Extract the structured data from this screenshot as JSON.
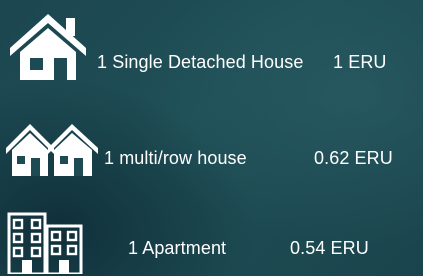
{
  "rows": [
    {
      "icon": "house-icon",
      "label": "1 Single Detached House",
      "value": "1 ERU"
    },
    {
      "icon": "row-houses-icon",
      "label": "1 multi/row house",
      "value": "0.62 ERU"
    },
    {
      "icon": "apartment-buildings-icon",
      "label": "1 Apartment",
      "value": "0.54 ERU"
    }
  ],
  "colors": {
    "icon": "#ffffff",
    "text": "#ffffff",
    "background": "#1f4f56"
  }
}
